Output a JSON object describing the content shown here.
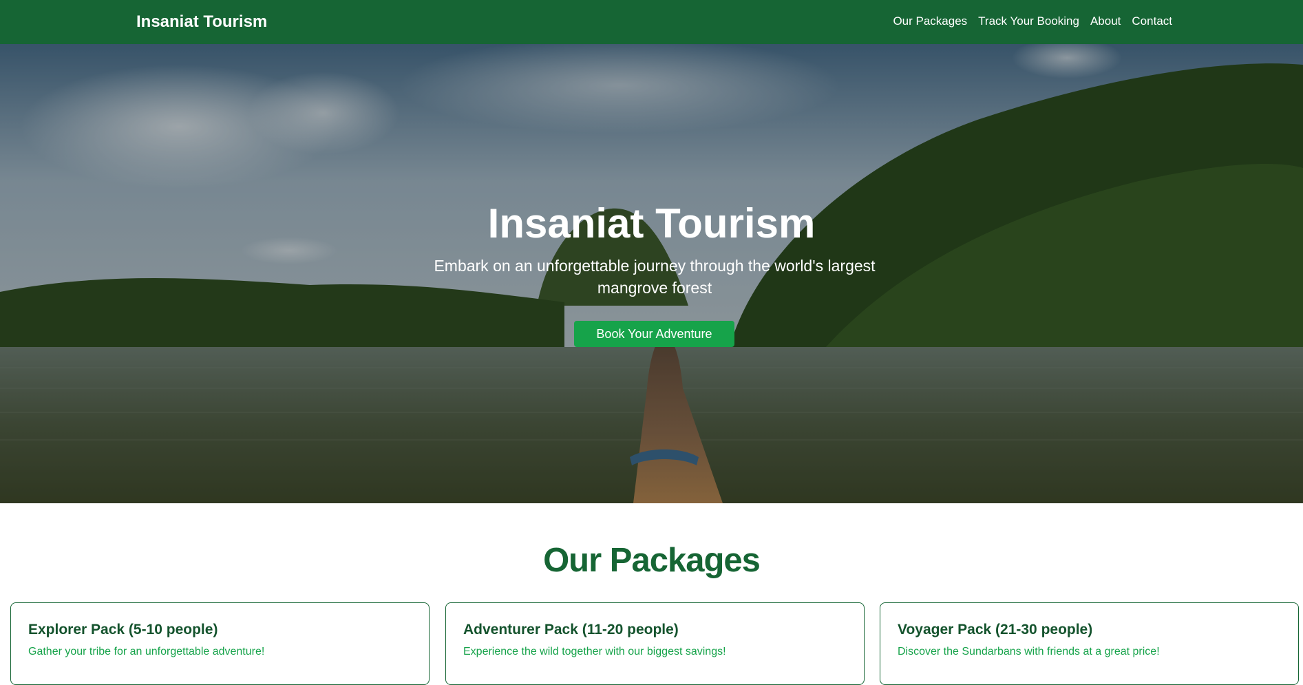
{
  "navbar": {
    "brand": "Insaniat Tourism",
    "links": [
      "Our Packages",
      "Track Your Booking",
      "About",
      "Contact"
    ]
  },
  "hero": {
    "title": "Insaniat Tourism",
    "subtitle": "Embark on an unforgettable journey through the world's largest mangrove forest",
    "cta": "Book Your Adventure"
  },
  "packages": {
    "heading": "Our Packages",
    "items": [
      {
        "title": "Explorer Pack (5-10 people)",
        "desc": "Gather your tribe for an unforgettable adventure!"
      },
      {
        "title": "Adventurer Pack (11-20 people)",
        "desc": "Experience the wild together with our biggest savings!"
      },
      {
        "title": "Voyager Pack (21-30 people)",
        "desc": "Discover the Sundarbans with friends at a great price!"
      }
    ]
  },
  "colors": {
    "primary": "#166534",
    "accent": "#16a34a"
  }
}
